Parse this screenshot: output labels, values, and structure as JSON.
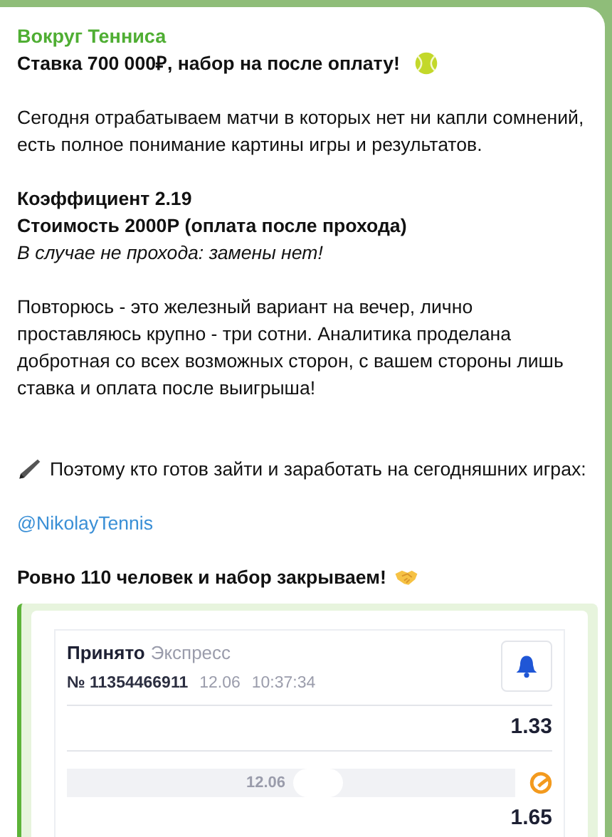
{
  "message": {
    "sender": "Вокруг Тенниса",
    "paragraphs": [
      {
        "blocks": [
          {
            "kind": "headline",
            "lines": [
              "Ставка 700 000₽, набор на после оплату!"
            ]
          }
        ]
      },
      {
        "blocks": [
          {
            "kind": "plain",
            "lines": [
              "Сегодня отрабатываем матчи в которых нет ни капли сомнений,",
              "есть полное понимание картины игры и результатов."
            ]
          }
        ]
      },
      {
        "blocks": [
          {
            "kind": "bold",
            "lines": [
              "Коэффициент 2.19"
            ]
          },
          {
            "kind": "bold",
            "lines": [
              "Стоимость 2000Р (оплата после прохода)"
            ]
          },
          {
            "kind": "italic",
            "lines": [
              "В случае не прохода: замены нет!"
            ]
          }
        ]
      },
      {
        "blocks": [
          {
            "kind": "plain",
            "lines": [
              "Повторюсь - это железный вариант на вечер, лично",
              "проставляюсь крупно - три сотни. Аналитика проделана",
              "добротная со всех возможных сторон, с вашем стороны лишь",
              "ставка и оплата после выигрыша!"
            ]
          }
        ]
      },
      {
        "blocks": [
          {
            "kind": "pencil",
            "lines": [
              "Поэтому кто готов зайти и заработать на сегодняшних играх:"
            ]
          }
        ]
      },
      {
        "blocks": [
          {
            "kind": "link",
            "lines": [
              "@NikolayTennis"
            ]
          }
        ]
      },
      {
        "blocks": [
          {
            "kind": "closing",
            "lines": [
              "Ровно 110 человек и набор закрываем!"
            ]
          }
        ]
      }
    ]
  },
  "bet_slip": {
    "status": "Принято",
    "type": "Экспресс",
    "number": "№ 11354466911",
    "date": "12.06",
    "time": "10:37:34",
    "events": [
      {
        "odds": "1.33"
      },
      {
        "date": "12.06",
        "odds": "1.65"
      }
    ]
  }
}
